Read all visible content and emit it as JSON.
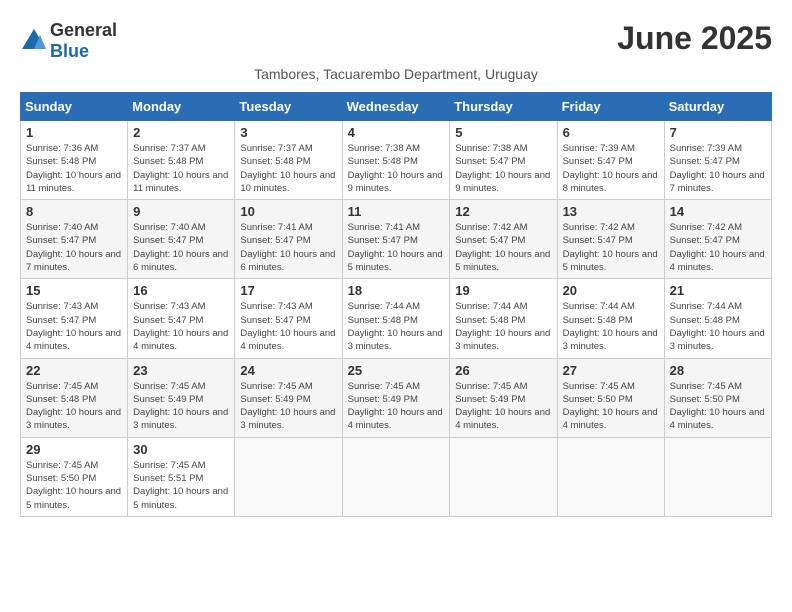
{
  "header": {
    "logo_general": "General",
    "logo_blue": "Blue",
    "month_title": "June 2025",
    "subtitle": "Tambores, Tacuarembo Department, Uruguay"
  },
  "columns": [
    "Sunday",
    "Monday",
    "Tuesday",
    "Wednesday",
    "Thursday",
    "Friday",
    "Saturday"
  ],
  "weeks": [
    [
      {
        "day": "1",
        "sunrise": "7:36 AM",
        "sunset": "5:48 PM",
        "daylight": "10 hours and 11 minutes."
      },
      {
        "day": "2",
        "sunrise": "7:37 AM",
        "sunset": "5:48 PM",
        "daylight": "10 hours and 11 minutes."
      },
      {
        "day": "3",
        "sunrise": "7:37 AM",
        "sunset": "5:48 PM",
        "daylight": "10 hours and 10 minutes."
      },
      {
        "day": "4",
        "sunrise": "7:38 AM",
        "sunset": "5:48 PM",
        "daylight": "10 hours and 9 minutes."
      },
      {
        "day": "5",
        "sunrise": "7:38 AM",
        "sunset": "5:47 PM",
        "daylight": "10 hours and 9 minutes."
      },
      {
        "day": "6",
        "sunrise": "7:39 AM",
        "sunset": "5:47 PM",
        "daylight": "10 hours and 8 minutes."
      },
      {
        "day": "7",
        "sunrise": "7:39 AM",
        "sunset": "5:47 PM",
        "daylight": "10 hours and 7 minutes."
      }
    ],
    [
      {
        "day": "8",
        "sunrise": "7:40 AM",
        "sunset": "5:47 PM",
        "daylight": "10 hours and 7 minutes."
      },
      {
        "day": "9",
        "sunrise": "7:40 AM",
        "sunset": "5:47 PM",
        "daylight": "10 hours and 6 minutes."
      },
      {
        "day": "10",
        "sunrise": "7:41 AM",
        "sunset": "5:47 PM",
        "daylight": "10 hours and 6 minutes."
      },
      {
        "day": "11",
        "sunrise": "7:41 AM",
        "sunset": "5:47 PM",
        "daylight": "10 hours and 5 minutes."
      },
      {
        "day": "12",
        "sunrise": "7:42 AM",
        "sunset": "5:47 PM",
        "daylight": "10 hours and 5 minutes."
      },
      {
        "day": "13",
        "sunrise": "7:42 AM",
        "sunset": "5:47 PM",
        "daylight": "10 hours and 5 minutes."
      },
      {
        "day": "14",
        "sunrise": "7:42 AM",
        "sunset": "5:47 PM",
        "daylight": "10 hours and 4 minutes."
      }
    ],
    [
      {
        "day": "15",
        "sunrise": "7:43 AM",
        "sunset": "5:47 PM",
        "daylight": "10 hours and 4 minutes."
      },
      {
        "day": "16",
        "sunrise": "7:43 AM",
        "sunset": "5:47 PM",
        "daylight": "10 hours and 4 minutes."
      },
      {
        "day": "17",
        "sunrise": "7:43 AM",
        "sunset": "5:47 PM",
        "daylight": "10 hours and 4 minutes."
      },
      {
        "day": "18",
        "sunrise": "7:44 AM",
        "sunset": "5:48 PM",
        "daylight": "10 hours and 3 minutes."
      },
      {
        "day": "19",
        "sunrise": "7:44 AM",
        "sunset": "5:48 PM",
        "daylight": "10 hours and 3 minutes."
      },
      {
        "day": "20",
        "sunrise": "7:44 AM",
        "sunset": "5:48 PM",
        "daylight": "10 hours and 3 minutes."
      },
      {
        "day": "21",
        "sunrise": "7:44 AM",
        "sunset": "5:48 PM",
        "daylight": "10 hours and 3 minutes."
      }
    ],
    [
      {
        "day": "22",
        "sunrise": "7:45 AM",
        "sunset": "5:48 PM",
        "daylight": "10 hours and 3 minutes."
      },
      {
        "day": "23",
        "sunrise": "7:45 AM",
        "sunset": "5:49 PM",
        "daylight": "10 hours and 3 minutes."
      },
      {
        "day": "24",
        "sunrise": "7:45 AM",
        "sunset": "5:49 PM",
        "daylight": "10 hours and 3 minutes."
      },
      {
        "day": "25",
        "sunrise": "7:45 AM",
        "sunset": "5:49 PM",
        "daylight": "10 hours and 4 minutes."
      },
      {
        "day": "26",
        "sunrise": "7:45 AM",
        "sunset": "5:49 PM",
        "daylight": "10 hours and 4 minutes."
      },
      {
        "day": "27",
        "sunrise": "7:45 AM",
        "sunset": "5:50 PM",
        "daylight": "10 hours and 4 minutes."
      },
      {
        "day": "28",
        "sunrise": "7:45 AM",
        "sunset": "5:50 PM",
        "daylight": "10 hours and 4 minutes."
      }
    ],
    [
      {
        "day": "29",
        "sunrise": "7:45 AM",
        "sunset": "5:50 PM",
        "daylight": "10 hours and 5 minutes."
      },
      {
        "day": "30",
        "sunrise": "7:45 AM",
        "sunset": "5:51 PM",
        "daylight": "10 hours and 5 minutes."
      },
      null,
      null,
      null,
      null,
      null
    ]
  ]
}
